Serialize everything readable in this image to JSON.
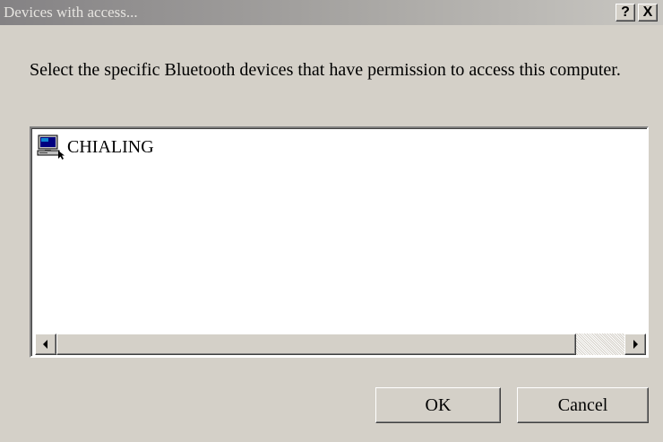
{
  "window": {
    "title": "Devices with access...",
    "help_label": "?",
    "close_label": "X"
  },
  "prompt": "Select the specific Bluetooth devices that have permission to access this computer.",
  "devices": [
    {
      "name": "CHIALING",
      "icon": "computer-icon"
    }
  ],
  "buttons": {
    "ok": "OK",
    "cancel": "Cancel"
  },
  "colors": {
    "dialog_bg": "#d4d0c8",
    "list_bg": "#ffffff",
    "title_gradient_start": "#848284"
  }
}
